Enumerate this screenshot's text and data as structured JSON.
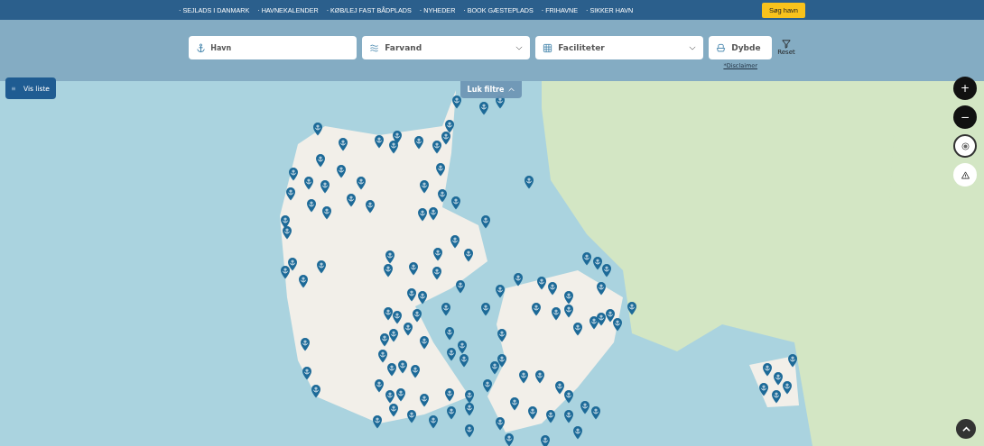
{
  "top_nav": {
    "items": [
      "· SEJLADS I DANMARK",
      "· HAVNEKALENDER",
      "· KØB/LEJ FAST BÅDPLADS",
      "· NYHEDER",
      "· BOOK GÆSTEPLADS",
      "· FRIHAVNE",
      "· SIKKER HAVN"
    ],
    "cta": "Søg havn"
  },
  "filters": {
    "harbor": {
      "placeholder": "Havn"
    },
    "fields": [
      {
        "label": "Farvand",
        "kind": "waves"
      },
      {
        "label": "Faciliteter",
        "kind": "grid"
      }
    ],
    "depth": {
      "label": "Dybde"
    },
    "reset": "Reset",
    "disclaimer": "*Disclaimer",
    "close": "Luk filtre"
  },
  "list_button": "Vis liste",
  "map_controls": {
    "zoom_in": "+",
    "zoom_out": "−"
  }
}
